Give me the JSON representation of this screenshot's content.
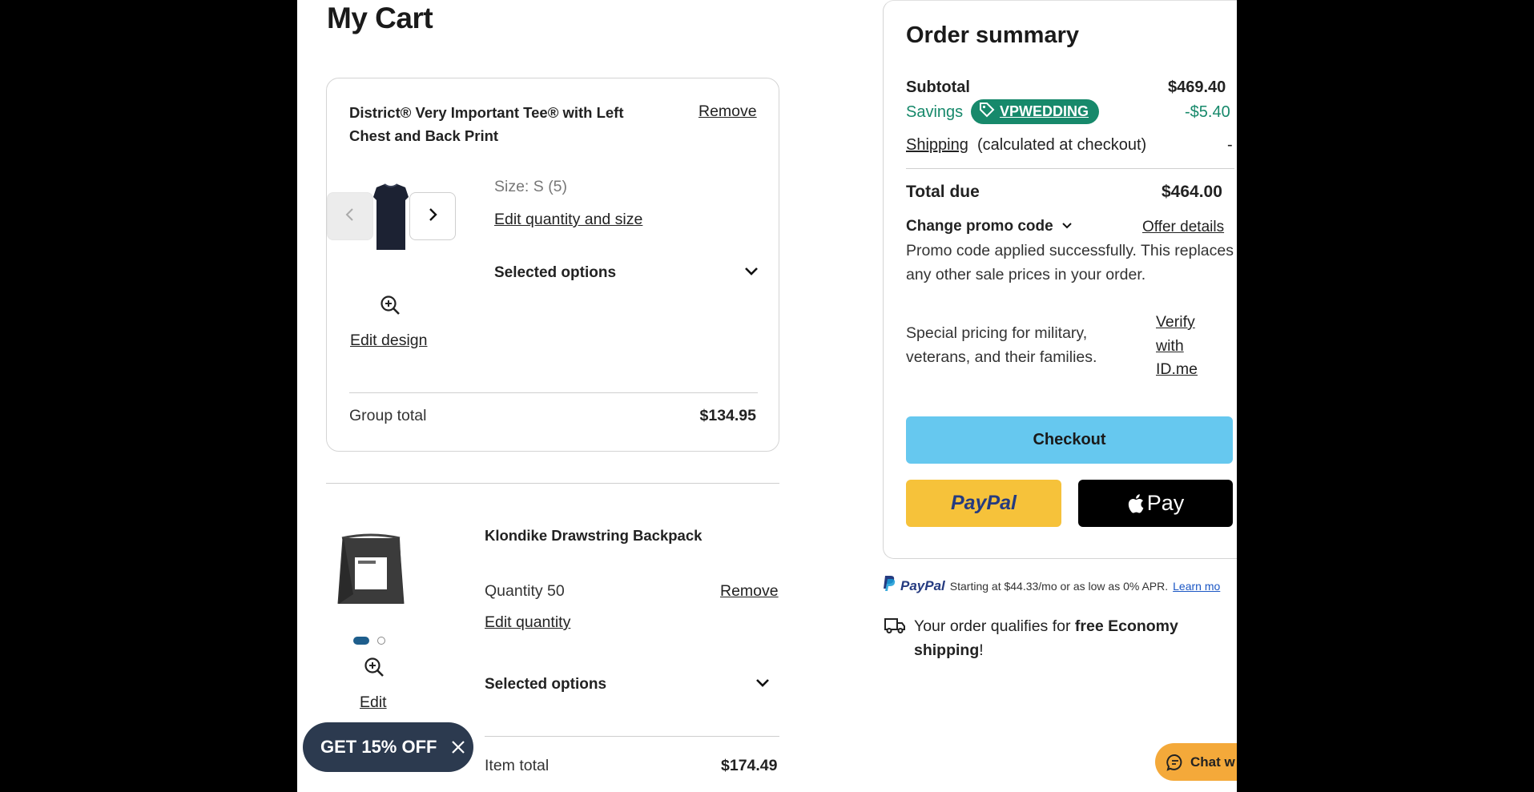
{
  "page": {
    "title": "My Cart"
  },
  "cart": {
    "item1": {
      "name": "District® Very Important Tee® with Left Chest and Back Print",
      "remove": "Remove",
      "size": "Size: S (5)",
      "edit_quantity_size": "Edit quantity and size",
      "selected_options": "Selected options",
      "edit_design": "Edit design",
      "group_total_label": "Group total",
      "group_total_value": "$134.95"
    },
    "item2": {
      "name": "Klondike Drawstring Backpack",
      "quantity": "Quantity 50",
      "remove": "Remove",
      "edit_quantity": "Edit quantity",
      "selected_options": "Selected options",
      "edit": "Edit",
      "item_total_label": "Item total",
      "item_total_value": "$174.49"
    }
  },
  "summary": {
    "title": "Order summary",
    "subtotal_label": "Subtotal",
    "subtotal_value": "$469.40",
    "savings_label": "Savings",
    "promo_code": "VPWEDDING",
    "savings_value": "-$5.40",
    "shipping_link": "Shipping",
    "shipping_note": "(calculated at checkout)",
    "shipping_value": "-",
    "total_label": "Total due",
    "total_value": "$464.00",
    "change_promo": "Change promo code",
    "offer_details": "Offer details",
    "promo_message": "Promo code applied successfully. This replaces any other sale prices in your order.",
    "military_text": "Special pricing for military, veterans, and their families.",
    "verify_link": "Verify with ID.me",
    "checkout": "Checkout",
    "paypal": "PayPal",
    "apple_pay": "Pay"
  },
  "paypal_credit": {
    "brand": "PayPal",
    "text": "Starting at $44.33/mo or as low as 0% APR.",
    "learn_more": "Learn mo"
  },
  "shipping_notice": {
    "pre": "Your order qualifies for ",
    "bold": "free Economy shipping",
    "post": "!"
  },
  "promo_banner": {
    "label": "GET 15% OFF"
  },
  "chat": {
    "label": "Chat w"
  },
  "colors": {
    "savings_green": "#17896b",
    "checkout_blue": "#66c8ef",
    "paypal_yellow": "#f6c23a",
    "chat_orange": "#f4a93a",
    "banner_navy": "#2c3a4f"
  },
  "icons": [
    "chevron-left-icon",
    "chevron-right-icon",
    "zoom-in-icon",
    "chevron-down-icon",
    "tag-icon",
    "apple-icon",
    "truck-icon",
    "close-icon",
    "chat-bubble-icon"
  ]
}
